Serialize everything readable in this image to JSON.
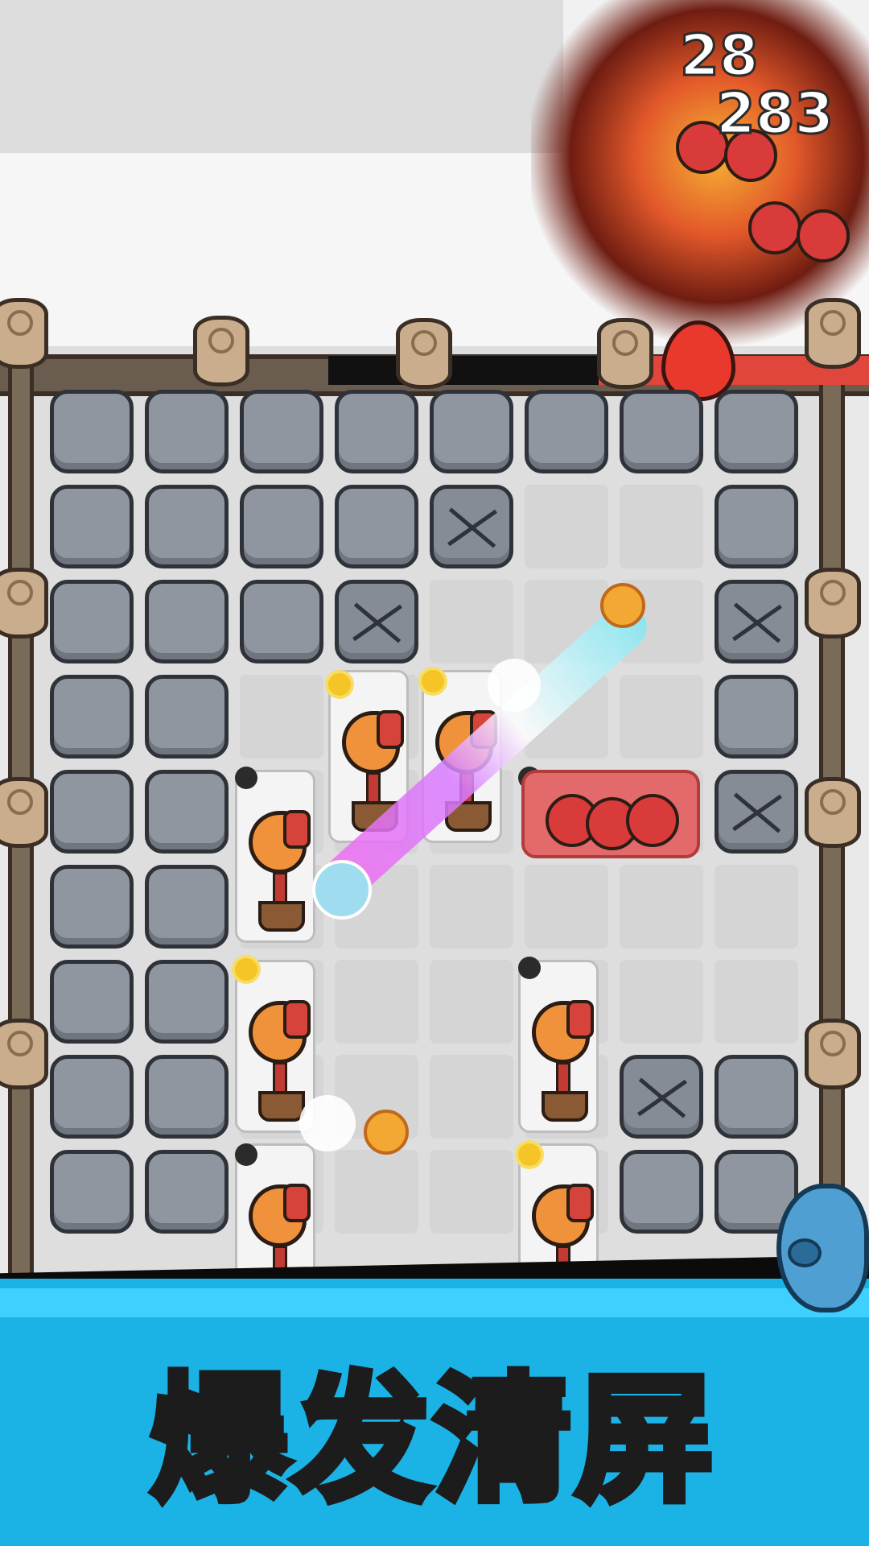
{
  "hud": {
    "damage_numbers": [
      "28",
      "283"
    ]
  },
  "banner": {
    "title": "爆发清屏"
  },
  "boss_health": {
    "fraction": 0.5
  },
  "colors": {
    "banner_blue": "#1bb3e6",
    "block_gray": "#8f96a0",
    "health_red": "#e0463b",
    "plant_orange": "#f0913b"
  },
  "icons": [
    "log-post-icon",
    "stone-block-icon",
    "cracked-stone-icon",
    "sunflower-coin-icon",
    "fire-plant-icon",
    "tomato-enemy-icon",
    "flame-icon",
    "piggy-bank-icon",
    "sun-token-icon",
    "bomb-token-icon"
  ]
}
